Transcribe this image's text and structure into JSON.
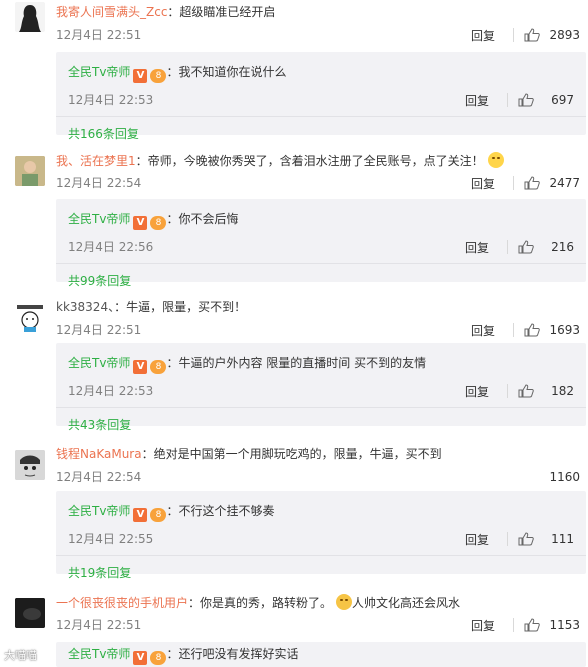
{
  "colors": {
    "link_orange": "#eb7350",
    "link_green": "#2eaf44",
    "sub_bg": "#f2f2f5",
    "time_gray": "#808080"
  },
  "reply_label": "回复",
  "comments": [
    {
      "avatar": "avatar-silhouette",
      "name": "我寄人间雪满头_Zcc",
      "text": "：超级瞄准已经开启",
      "time": "12月4日 22:51",
      "likes": "2893",
      "reply": {
        "name": "全民Tv帝师",
        "badge_v": "V",
        "badge_fan": "8",
        "text": "：我不知道你在说什么",
        "time": "12月4日 22:53",
        "likes": "697"
      },
      "more": "共166条回复"
    },
    {
      "avatar": "avatar-photo",
      "name": "我、活在梦里1",
      "text": "：帝师，今晚被你秀哭了，含着泪水注册了全民账号，点了关注！",
      "emoji": "laugh-cry-emoji",
      "time": "12月4日 22:54",
      "likes": "2477",
      "reply": {
        "name": "全民Tv帝师",
        "badge_v": "V",
        "badge_fan": "8",
        "text": "：你不会后悔",
        "time": "12月4日 22:56",
        "likes": "216"
      },
      "more": "共99条回复"
    },
    {
      "avatar": "avatar-cartoon",
      "name": "kk38324、",
      "text": "：牛逼，限量，买不到！",
      "time": "12月4日 22:51",
      "likes": "1693",
      "reply": {
        "name": "全民Tv帝师",
        "badge_v": "V",
        "badge_fan": "8",
        "text": "：牛逼的户外内容 限量的直播时间 买不到的友情",
        "time": "12月4日 22:53",
        "likes": "182"
      },
      "more": "共43条回复"
    },
    {
      "avatar": "avatar-sketch",
      "name": "钱程NaKaMura",
      "text": "：绝对是中国第一个用脚玩吃鸡的，限量，牛逼，买不到",
      "time": "12月4日 22:54",
      "likes": "1160",
      "reply": {
        "name": "全民Tv帝师",
        "badge_v": "V",
        "badge_fan": "8",
        "text": "：不行这个挂不够奏",
        "time": "12月4日 22:55",
        "likes": "111"
      },
      "more": "共19条回复"
    },
    {
      "avatar": "avatar-dark",
      "name": "一个很丧很丧的手机用户",
      "text": "：你是真的秀，路转粉了。",
      "emoji": "happy-emoji",
      "text_after": "人帅文化高还会风水",
      "time": "12月4日 22:51",
      "likes": "1153",
      "reply": {
        "name": "全民Tv帝师",
        "badge_v": "V",
        "badge_fan": "8",
        "text": "：还行吧没有发挥好实话"
      }
    }
  ],
  "watermark": "大喵喵"
}
